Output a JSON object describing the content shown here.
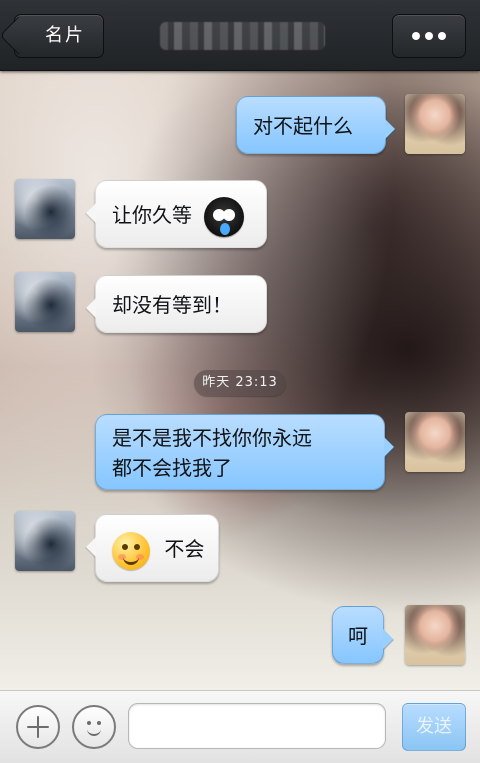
{
  "header": {
    "back_label": "名片",
    "more_icon": "more-dots-icon"
  },
  "messages": [
    {
      "sender": "self",
      "text": "对不起什么"
    },
    {
      "sender": "other",
      "text": "让你久等",
      "emoji": "crying-owl-emoji"
    },
    {
      "sender": "other",
      "text": "却没有等到！"
    },
    {
      "type": "timestamp",
      "text": "昨天 23:13"
    },
    {
      "sender": "self",
      "lines": [
        "是不是我不找你你永远",
        "都不会找我了"
      ]
    },
    {
      "sender": "other",
      "emoji": "shy-smiley-emoji",
      "text": "不会"
    },
    {
      "sender": "self",
      "text": "呵"
    }
  ],
  "composer": {
    "input_value": "",
    "send_label": "发送",
    "plus_icon": "plus-icon",
    "emoji_icon": "emoji-icon"
  },
  "colors": {
    "topbar": "#23262a",
    "self_bubble": "#9dd2ff",
    "other_bubble": "#f5f5f5",
    "send_button": "#8bc5f3"
  }
}
